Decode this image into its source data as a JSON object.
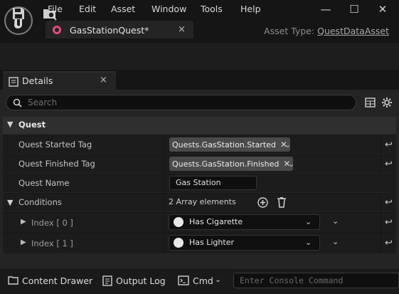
{
  "menu": [
    "File",
    "Edit",
    "Asset",
    "Window",
    "Tools",
    "Help"
  ],
  "window_controls": {
    "minimize": "—",
    "maximize": "☐",
    "close": "✕"
  },
  "document_tab": {
    "title": "GasStationQuest*",
    "close": "×",
    "accent_color": "#e04c7f"
  },
  "asset_type": {
    "label": "Asset Type:",
    "value": "QuestDataAsset"
  },
  "toolbar": {
    "icons": [
      "save-icon",
      "browse-icon"
    ]
  },
  "details_tab": {
    "title": "Details",
    "close": "×"
  },
  "search": {
    "placeholder": "Search"
  },
  "category": {
    "label": "Quest"
  },
  "rows": {
    "started_label": "Quest Started Tag",
    "started_tag": "Quests.GasStation.Started",
    "finished_label": "Quest Finished Tag",
    "finished_tag": "Quests.GasStation.Finished",
    "name_label": "Quest Name",
    "name_value": "Gas Station",
    "conditions_label": "Conditions",
    "conditions_count": "2 Array elements",
    "index0_label": "Index [ 0 ]",
    "index0_value": "Has Cigarette",
    "index1_label": "Index [ 1 ]",
    "index1_value": "Has Lighter"
  },
  "bottom": {
    "content_drawer": "Content Drawer",
    "output_log": "Output Log",
    "cmd": "Cmd",
    "console_placeholder": "Enter Console Command"
  }
}
